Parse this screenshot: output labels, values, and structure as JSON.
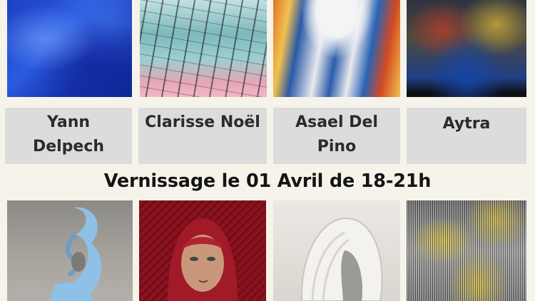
{
  "artists": [
    {
      "name_lines": [
        "Yann",
        "Delpech"
      ],
      "artwork": "blue-abstract-painting"
    },
    {
      "name_lines": [
        "Clarisse Noël"
      ],
      "artwork": "teal-reflection-painting"
    },
    {
      "name_lines": [
        "Asael Del",
        "Pino"
      ],
      "artwork": "blue-white-flowing-painting"
    },
    {
      "name_lines": [
        "Aytra"
      ],
      "artwork": "dark-abstract-painting"
    }
  ],
  "headline": "Vernissage le 01 Avril de 18-21h",
  "bottom_artworks": [
    "light-blue-sculpture",
    "portrait-red-veil-painting",
    "white-ceramic-sculpture",
    "yellow-kinetic-artwork"
  ],
  "colors": {
    "background": "#f6f3ea",
    "panel": "#dcdcdc",
    "text": "#2b2b2b"
  }
}
